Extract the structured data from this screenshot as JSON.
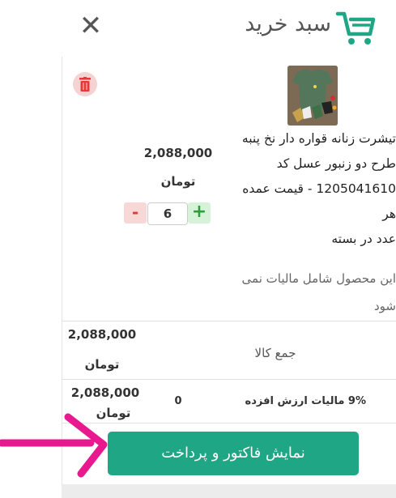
{
  "header": {
    "title": "سبد خرید",
    "close_symbol": "✕",
    "cart_icon": "shopping-cart-icon",
    "accent_color": "#1fa685"
  },
  "item": {
    "desc_lines": [
      "تیشرت زنانه قواره دار نخ پنبه",
      "طرح دو زنبور عسل کد",
      "1205041610 - قیمت عمده هر",
      "عدد در بسته"
    ],
    "tax_lines": [
      "این محصول شامل مالیات نمی",
      "شود"
    ],
    "price": "2,088,000",
    "currency": "تومان",
    "quantity": "6",
    "minus_label": "-",
    "plus_label": "+",
    "delete_icon": "trash-icon"
  },
  "summary": {
    "total_label": "جمع کالا",
    "total_amount": "2,088,000",
    "total_currency": "تومان",
    "vat_label": "9% مالیات ارزش افزده",
    "vat_value": "0",
    "grand_amount": "2,088,000",
    "grand_currency": "تومان"
  },
  "checkout": {
    "label": "نمایش فاکتور و پرداخت"
  },
  "annotation": {
    "arrow_color": "#e8188f"
  }
}
